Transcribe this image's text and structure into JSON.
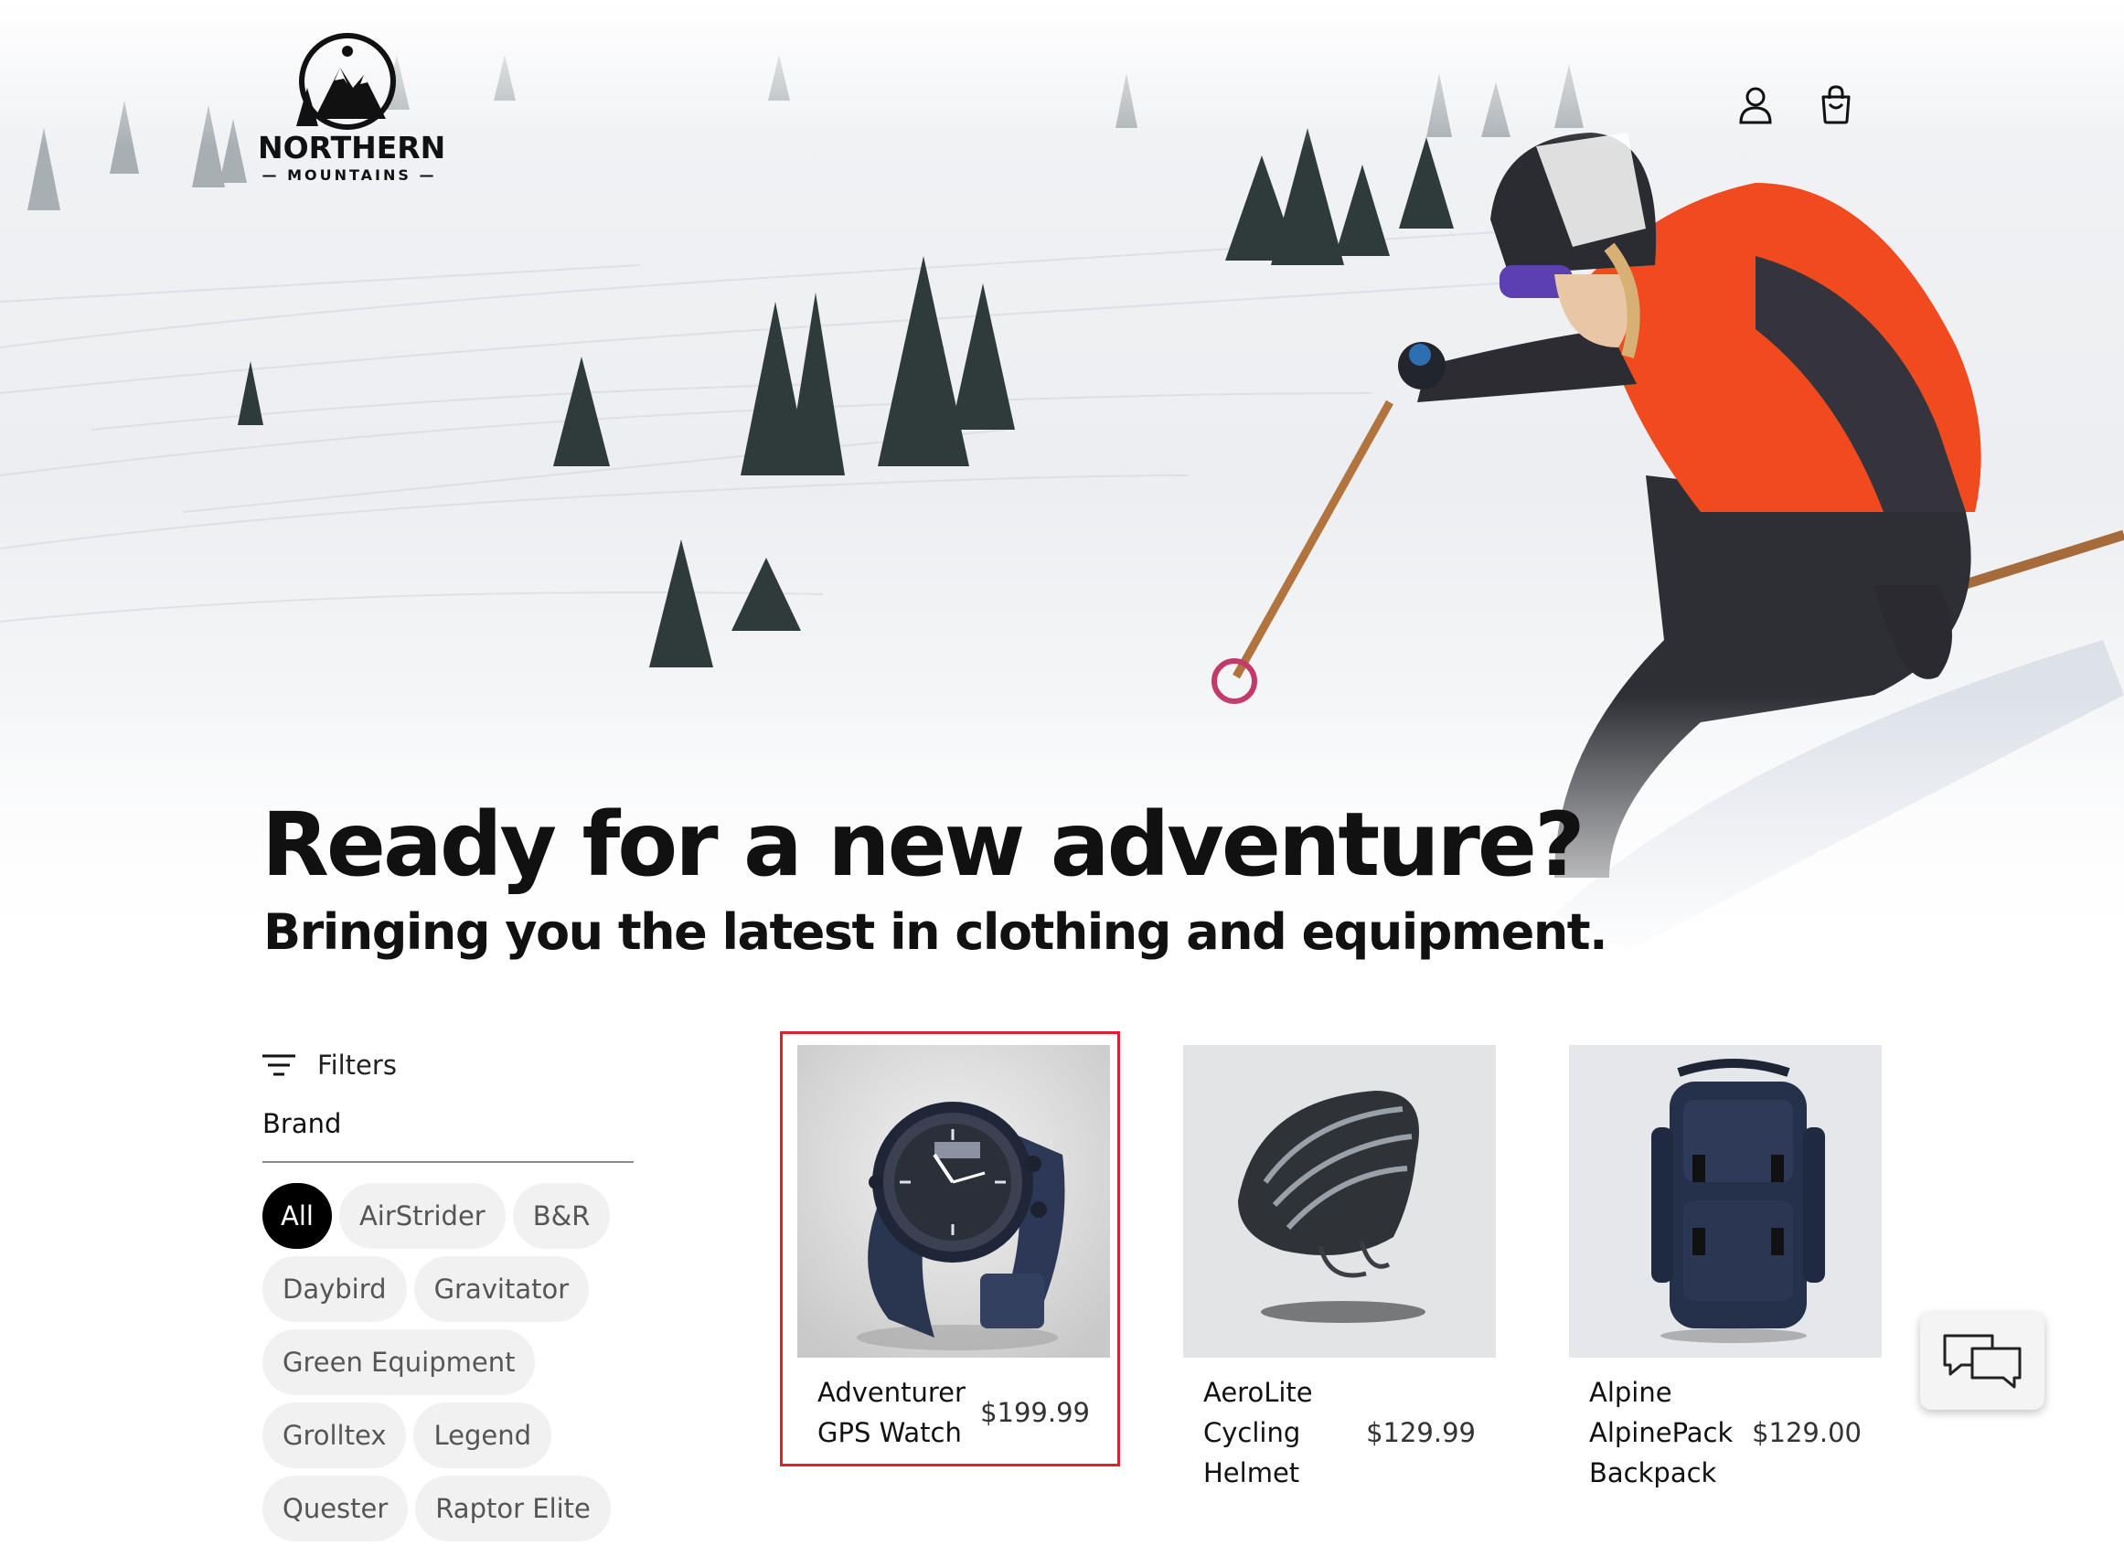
{
  "header": {
    "logo": {
      "line1": "NORTHERN",
      "line2": "— MOUNTAINS —"
    },
    "icons": [
      "account-icon",
      "shopping-bag-icon"
    ]
  },
  "hero": {
    "headline": "Ready for a new adventure?",
    "subheadline": "Bringing you the latest in clothing and equipment."
  },
  "filters": {
    "label": "Filters",
    "section_title": "Brand",
    "brands": [
      {
        "label": "All",
        "selected": true
      },
      {
        "label": "AirStrider",
        "selected": false
      },
      {
        "label": "B&R",
        "selected": false
      },
      {
        "label": "Daybird",
        "selected": false
      },
      {
        "label": "Gravitator",
        "selected": false
      },
      {
        "label": "Green Equipment",
        "selected": false
      },
      {
        "label": "Grolltex",
        "selected": false
      },
      {
        "label": "Legend",
        "selected": false
      },
      {
        "label": "Quester",
        "selected": false
      },
      {
        "label": "Raptor Elite",
        "selected": false
      }
    ]
  },
  "products": [
    {
      "name": "Adventurer GPS Watch",
      "price": "$199.99",
      "image": "gps-watch",
      "highlighted": true
    },
    {
      "name": "AeroLite Cycling Helmet",
      "price": "$129.99",
      "image": "cycling-helmet",
      "highlighted": false
    },
    {
      "name": "Alpine AlpinePack Backpack",
      "price": "$129.00",
      "image": "backpack",
      "highlighted": false
    }
  ],
  "chat": {
    "icon": "chat-bubbles-icon"
  },
  "colors": {
    "highlight": "#e0202a",
    "jacket": "#f04a1e",
    "text": "#111111",
    "chip_bg": "#f1f1f1"
  }
}
